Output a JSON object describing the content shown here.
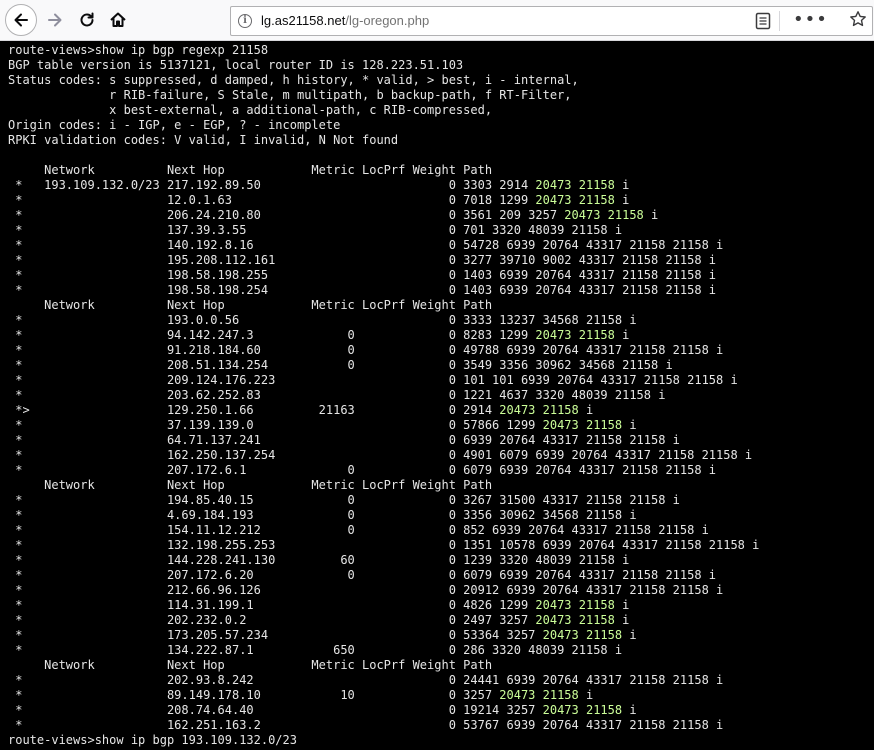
{
  "browser": {
    "url_host": "lg.as21158.net",
    "url_path": "/lg-oregon.php",
    "icons": [
      "back-arrow-icon",
      "forward-arrow-icon",
      "reload-icon",
      "home-icon",
      "info-icon",
      "reader-view-icon",
      "more-options-icon",
      "bookmark-star-icon"
    ]
  },
  "terminal": {
    "text_color": "#e6e6e6",
    "highlight_color": "#ccff99",
    "background": "#000000",
    "highlight_terms": [
      "20473 21158"
    ],
    "lines": [
      "route-views>show ip bgp regexp 21158",
      "BGP table version is 5137121, local router ID is 128.223.51.103",
      "Status codes: s suppressed, d damped, h history, * valid, > best, i - internal,",
      "              r RIB-failure, S Stale, m multipath, b backup-path, f RT-Filter,",
      "              x best-external, a additional-path, c RIB-compressed,",
      "Origin codes: i - IGP, e - EGP, ? - incomplete",
      "RPKI validation codes: V valid, I invalid, N Not found",
      "",
      "     Network          Next Hop            Metric LocPrf Weight Path",
      " *   193.109.132.0/23 217.192.89.50                          0 3303 2914 20473 21158 i",
      " *                    12.0.1.63                              0 7018 1299 20473 21158 i",
      " *                    206.24.210.80                          0 3561 209 3257 20473 21158 i",
      " *                    137.39.3.55                            0 701 3320 48039 21158 i",
      " *                    140.192.8.16                           0 54728 6939 20764 43317 21158 21158 i",
      " *                    195.208.112.161                        0 3277 39710 9002 43317 21158 21158 i",
      " *                    198.58.198.255                         0 1403 6939 20764 43317 21158 21158 i",
      " *                    198.58.198.254                         0 1403 6939 20764 43317 21158 21158 i",
      "     Network          Next Hop            Metric LocPrf Weight Path",
      " *                    193.0.0.56                             0 3333 13237 34568 21158 i",
      " *                    94.142.247.3             0             0 8283 1299 20473 21158 i",
      " *                    91.218.184.60            0             0 49788 6939 20764 43317 21158 21158 i",
      " *                    208.51.134.254           0             0 3549 3356 30962 34568 21158 i",
      " *                    209.124.176.223                        0 101 101 6939 20764 43317 21158 21158 i",
      " *                    203.62.252.83                          0 1221 4637 3320 48039 21158 i",
      " *>                   129.250.1.66         21163             0 2914 20473 21158 i",
      " *                    37.139.139.0                           0 57866 1299 20473 21158 i",
      " *                    64.71.137.241                          0 6939 20764 43317 21158 21158 i",
      " *                    162.250.137.254                        0 4901 6079 6939 20764 43317 21158 21158 i",
      " *                    207.172.6.1              0             0 6079 6939 20764 43317 21158 21158 i",
      "     Network          Next Hop            Metric LocPrf Weight Path",
      " *                    194.85.40.15             0             0 3267 31500 43317 21158 21158 i",
      " *                    4.69.184.193             0             0 3356 30962 34568 21158 i",
      " *                    154.11.12.212            0             0 852 6939 20764 43317 21158 21158 i",
      " *                    132.198.255.253                        0 1351 10578 6939 20764 43317 21158 21158 i",
      " *                    144.228.241.130         60             0 1239 3320 48039 21158 i",
      " *                    207.172.6.20             0             0 6079 6939 20764 43317 21158 21158 i",
      " *                    212.66.96.126                          0 20912 6939 20764 43317 21158 21158 i",
      " *                    114.31.199.1                           0 4826 1299 20473 21158 i",
      " *                    202.232.0.2                            0 2497 3257 20473 21158 i",
      " *                    173.205.57.234                         0 53364 3257 20473 21158 i",
      " *                    134.222.87.1           650             0 286 3320 48039 21158 i",
      "     Network          Next Hop            Metric LocPrf Weight Path",
      " *                    202.93.8.242                           0 24441 6939 20764 43317 21158 21158 i",
      " *                    89.149.178.10           10             0 3257 20473 21158 i",
      " *                    208.74.64.40                           0 19214 3257 20473 21158 i",
      " *                    162.251.163.2                          0 53767 6939 20764 43317 21158 21158 i",
      "route-views>show ip bgp 193.109.132.0/23"
    ]
  }
}
